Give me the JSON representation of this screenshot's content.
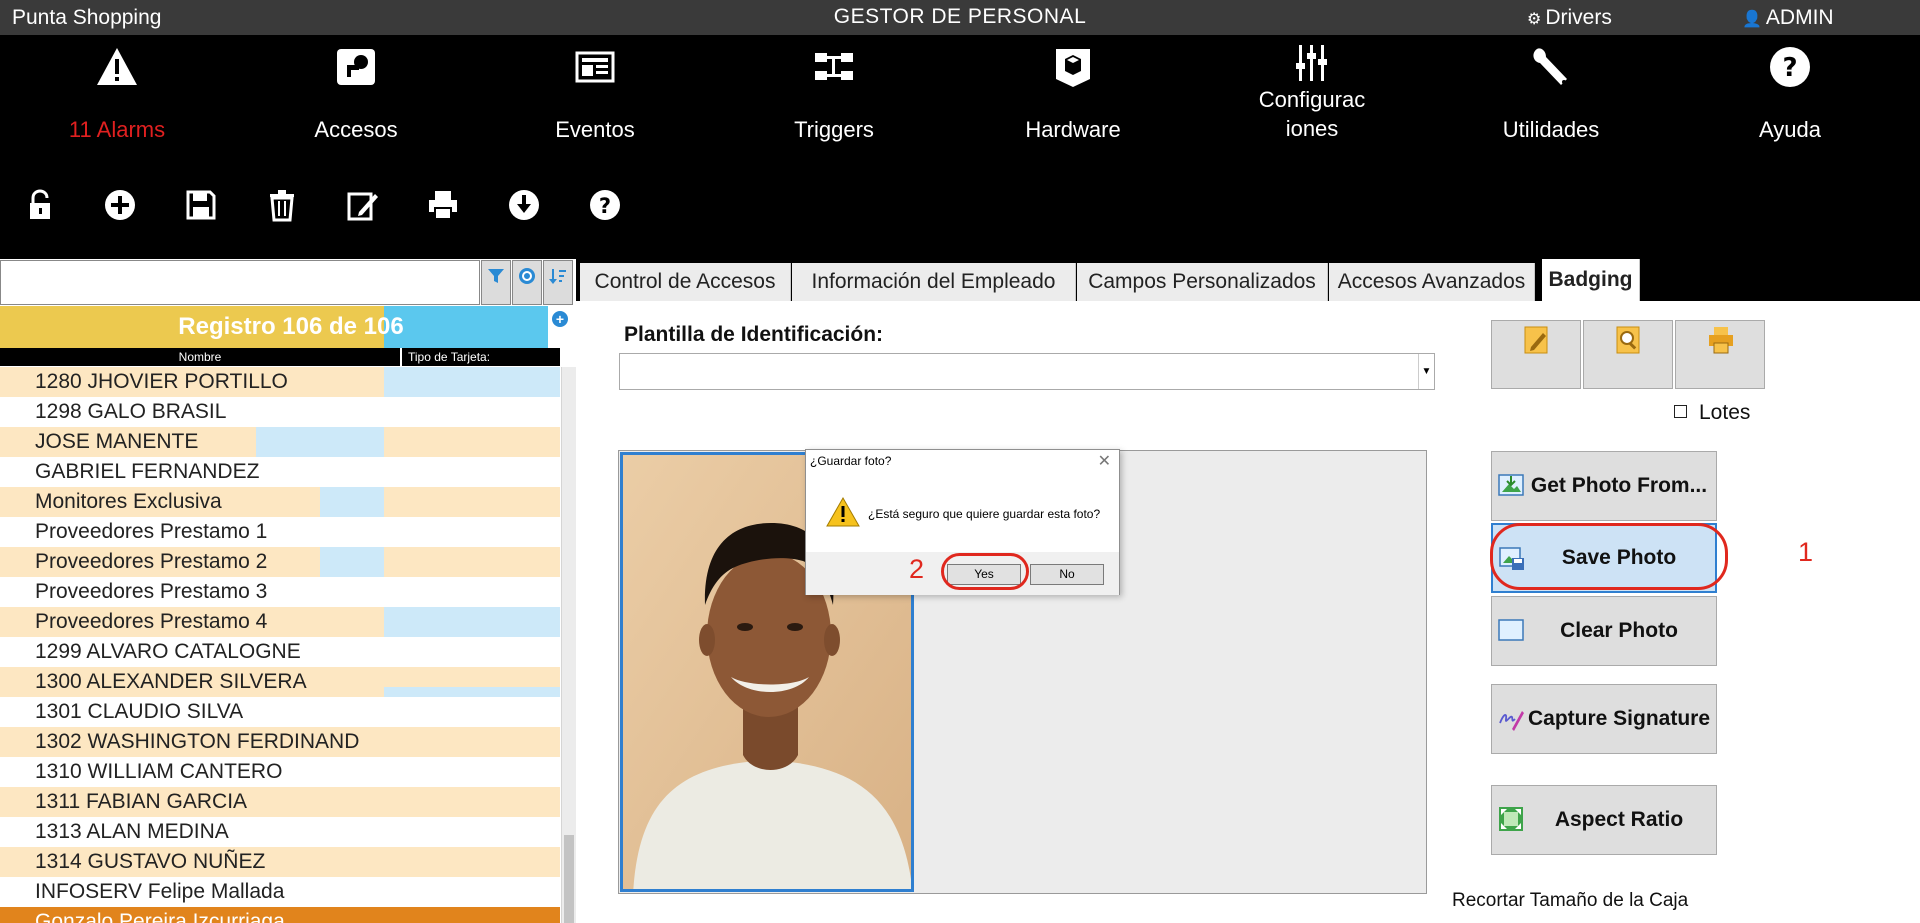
{
  "titlebar": {
    "app_name": "Punta Shopping",
    "center_title": "GESTOR DE PERSONAL",
    "drivers": "Drivers",
    "admin": "ADMIN"
  },
  "nav": [
    {
      "label": "11 Alarms",
      "icon": "warning-icon"
    },
    {
      "label": "Accesos",
      "icon": "key-card-icon"
    },
    {
      "label": "Eventos",
      "icon": "newspaper-icon"
    },
    {
      "label": "Triggers",
      "icon": "flow-icon"
    },
    {
      "label": "Hardware",
      "icon": "hardware-box-icon"
    },
    {
      "label_line1": "Configurac",
      "label_line2": "iones",
      "icon": "sliders-icon"
    },
    {
      "label": "Utilidades",
      "icon": "wrench-icon"
    },
    {
      "label": "Ayuda",
      "icon": "help-icon"
    }
  ],
  "toolbar": [
    "lock-icon",
    "add-icon",
    "save-icon",
    "trash-icon",
    "edit-icon",
    "print-icon",
    "download-icon",
    "help-icon"
  ],
  "left": {
    "registro": "Registro 106 de 106",
    "col_nombre": "Nombre",
    "col_tipo": "Tipo de Tarjeta:",
    "rows": [
      "1280 JHOVIER PORTILLO",
      "1298 GALO BRASIL",
      "JOSE  MANENTE",
      "GABRIEL FERNANDEZ",
      "Monitores Exclusiva",
      "Proveedores Prestamo 1",
      "Proveedores Prestamo 2",
      "Proveedores Prestamo 3",
      "Proveedores Prestamo 4",
      "1299 ALVARO CATALOGNE",
      "1300 ALEXANDER SILVERA",
      "1301 CLAUDIO SILVA",
      "1302 WASHINGTON FERDINAND",
      "1310 WILLIAM CANTERO",
      "1311 FABIAN GARCIA",
      "1313 ALAN MEDINA",
      "1314 GUSTAVO NUÑEZ",
      "INFOSERV Felipe Mallada",
      "Gonzalo Pereira Izcurriaga"
    ]
  },
  "tabs": [
    "Control de Accesos",
    "Información del Empleado",
    "Campos Personalizados",
    "Accesos Avanzados",
    "Badging"
  ],
  "badging": {
    "plantilla_label": "Plantilla de Identificación:",
    "plantilla_value": "",
    "lotes": "Lotes",
    "buttons": [
      "Get Photo From...",
      "Save Photo",
      "Clear Photo",
      "Capture Signature",
      "Aspect Ratio"
    ],
    "recortar": "Recortar Tamaño de la Caja"
  },
  "dialog": {
    "title": "¿Guardar foto?",
    "message": "¿Está seguro que quiere guardar esta foto?",
    "yes": "Yes",
    "no": "No"
  },
  "markers": {
    "one": "1",
    "two": "2"
  },
  "colors": {
    "accent_yellow": "#ecc94f",
    "accent_blue": "#5bc8ee",
    "row_peach": "#fde7c2",
    "marker_red": "#e0281e",
    "alarm_red": "#e02020"
  }
}
